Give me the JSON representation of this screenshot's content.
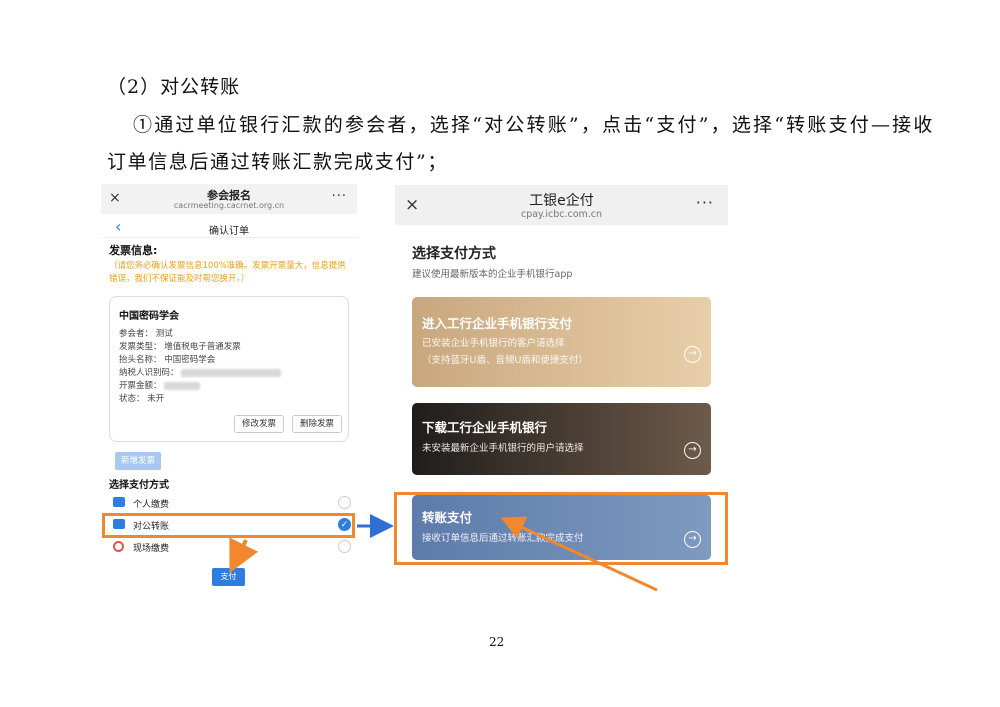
{
  "document": {
    "section_heading": "（2）对公转账",
    "paragraph_line1": "①通过单位银行汇款的参会者，选择“对公转账”，点击“支付”，选择“转账支付—接收",
    "paragraph_line2": "订单信息后通过转账汇款完成支付”；",
    "page_number": "22"
  },
  "left_phone": {
    "close_icon": "×",
    "title": "参会报名",
    "url": "cacrmeeting.cacrnet.org.cn",
    "more_icon": "···",
    "back_icon": "‹",
    "nav_title": "确认订单",
    "invoice_heading": "发票信息:",
    "invoice_note": "（请您务必确认发票信息100%准确。发票开票量大，信息提供错误，我们不保证能及时帮您换开。）",
    "card": {
      "title": "中国密码学会",
      "attendee": "参会者：  测试",
      "invoice_type": "发票类型：  增值税电子普通发票",
      "header_name": "抬头名称：  中国密码学会",
      "tax_id_label": "纳税人识别码：",
      "amount_label": "开票金额：",
      "status": "状态：  未开",
      "edit_button": "修改发票",
      "delete_button": "删除发票"
    },
    "add_invoice_button": "新增发票",
    "payment_heading": "选择支付方式",
    "payment_options": [
      {
        "label": "个人缴费",
        "checked": false,
        "icon_color": "#2f7de1"
      },
      {
        "label": "对公转账",
        "checked": true,
        "icon_color": "#2f7de1"
      },
      {
        "label": "现场缴费",
        "checked": false,
        "icon_color": "#e0554a"
      }
    ],
    "check_mark": "✓",
    "pay_button": "支付"
  },
  "right_phone": {
    "close_icon": "×",
    "title": "工银e企付",
    "url": "cpay.icbc.com.cn",
    "more_icon": "···",
    "heading": "选择支付方式",
    "subheading": "建议使用最新版本的企业手机银行app",
    "options": [
      {
        "title": "进入工行企业手机银行支付",
        "desc1": "已安装企业手机银行的客户请选择",
        "desc2": "（支持蓝牙U盾、音频U盾和便捷支付）"
      },
      {
        "title": "下载工行企业手机银行",
        "desc1": "未安装最新企业手机银行的用户请选择"
      },
      {
        "title": "转账支付",
        "desc1": "接收订单信息后通过转账汇款完成支付"
      }
    ],
    "arrow_icon": "→"
  },
  "colors": {
    "highlight": "#f1882d",
    "connector_arrow": "#2f6fd6",
    "accent_blue": "#2f7de1"
  }
}
